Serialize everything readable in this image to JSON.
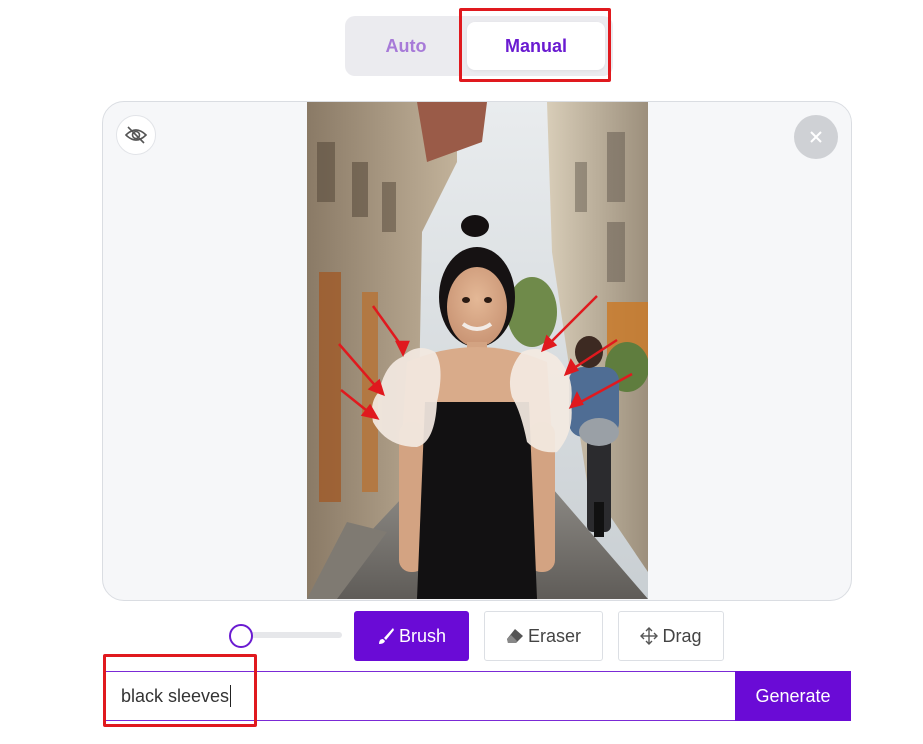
{
  "mode_toggle": {
    "auto_label": "Auto",
    "manual_label": "Manual",
    "selected": "Manual"
  },
  "tools": {
    "brush_label": "Brush",
    "eraser_label": "Eraser",
    "drag_label": "Drag",
    "active": "Brush",
    "brush_size_level": 0.0
  },
  "prompt": {
    "value": "black sleeves"
  },
  "generate": {
    "label": "Generate"
  },
  "icons": {
    "hide_mask": "eye-slash-icon",
    "close": "close-icon",
    "brush": "brush-icon",
    "eraser": "eraser-icon",
    "drag": "move-arrows-icon"
  },
  "colors": {
    "accent": "#6a0bd6",
    "annotation": "#e0191e",
    "mask": "#f3e9e1"
  }
}
